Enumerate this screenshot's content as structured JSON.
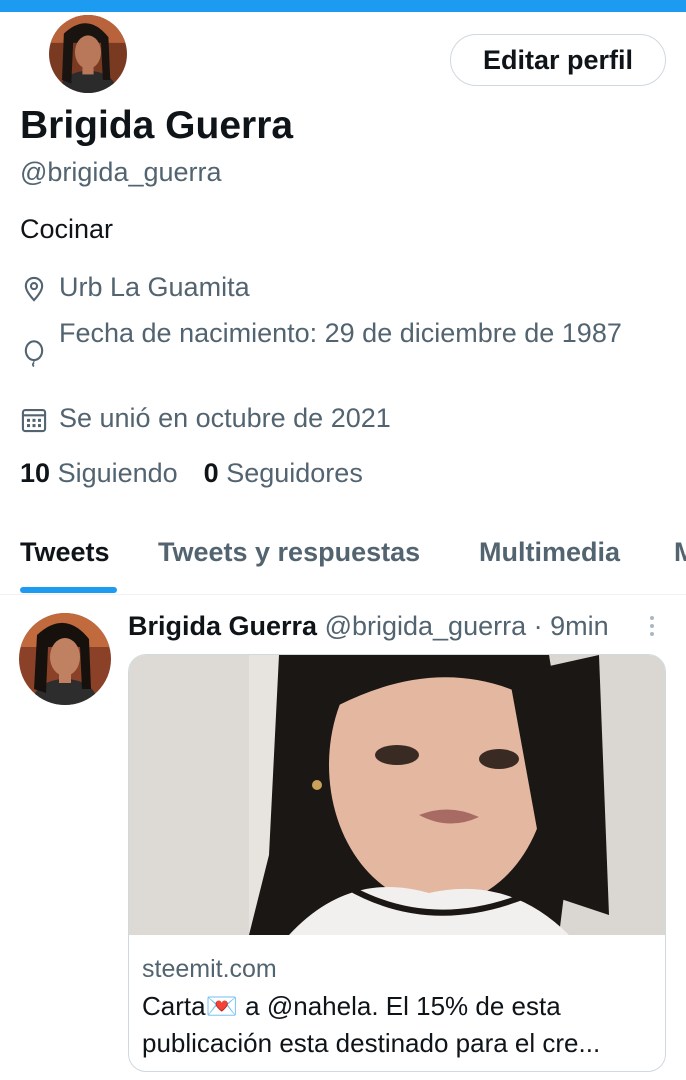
{
  "profile": {
    "edit_label": "Editar perfil",
    "name": "Brigida Guerra",
    "handle": "@brigida_guerra",
    "bio": "Cocinar",
    "location": "Urb La Guamita",
    "birth_date": "Fecha de nacimiento: 29 de diciembre de 1987",
    "joined": "Se unió en octubre de 2021",
    "following_count": "10",
    "following_label": "Siguiendo",
    "followers_count": "0",
    "followers_label": "Seguidores"
  },
  "tabs": [
    {
      "label": "Tweets",
      "active": true
    },
    {
      "label": "Tweets y respuestas"
    },
    {
      "label": "Multimedia"
    },
    {
      "label": "Me gusta"
    }
  ],
  "tweet": {
    "author_name": "Brigida Guerra",
    "author_handle": "@brigida_guerra",
    "separator": "·",
    "time": "9min",
    "card": {
      "domain": "steemit.com",
      "text_line1": "Carta💌 a @nahela. El 15% de esta",
      "text_line2": "publicación esta destinado para el cre..."
    }
  },
  "colors": {
    "accent": "#1d9bf0",
    "text_primary": "#0f1419",
    "text_secondary": "#536471",
    "border": "#cfd9de"
  },
  "icons": {
    "location": "location-pin-icon",
    "birth": "balloon-icon",
    "joined": "calendar-icon",
    "more": "more-dots-icon"
  }
}
